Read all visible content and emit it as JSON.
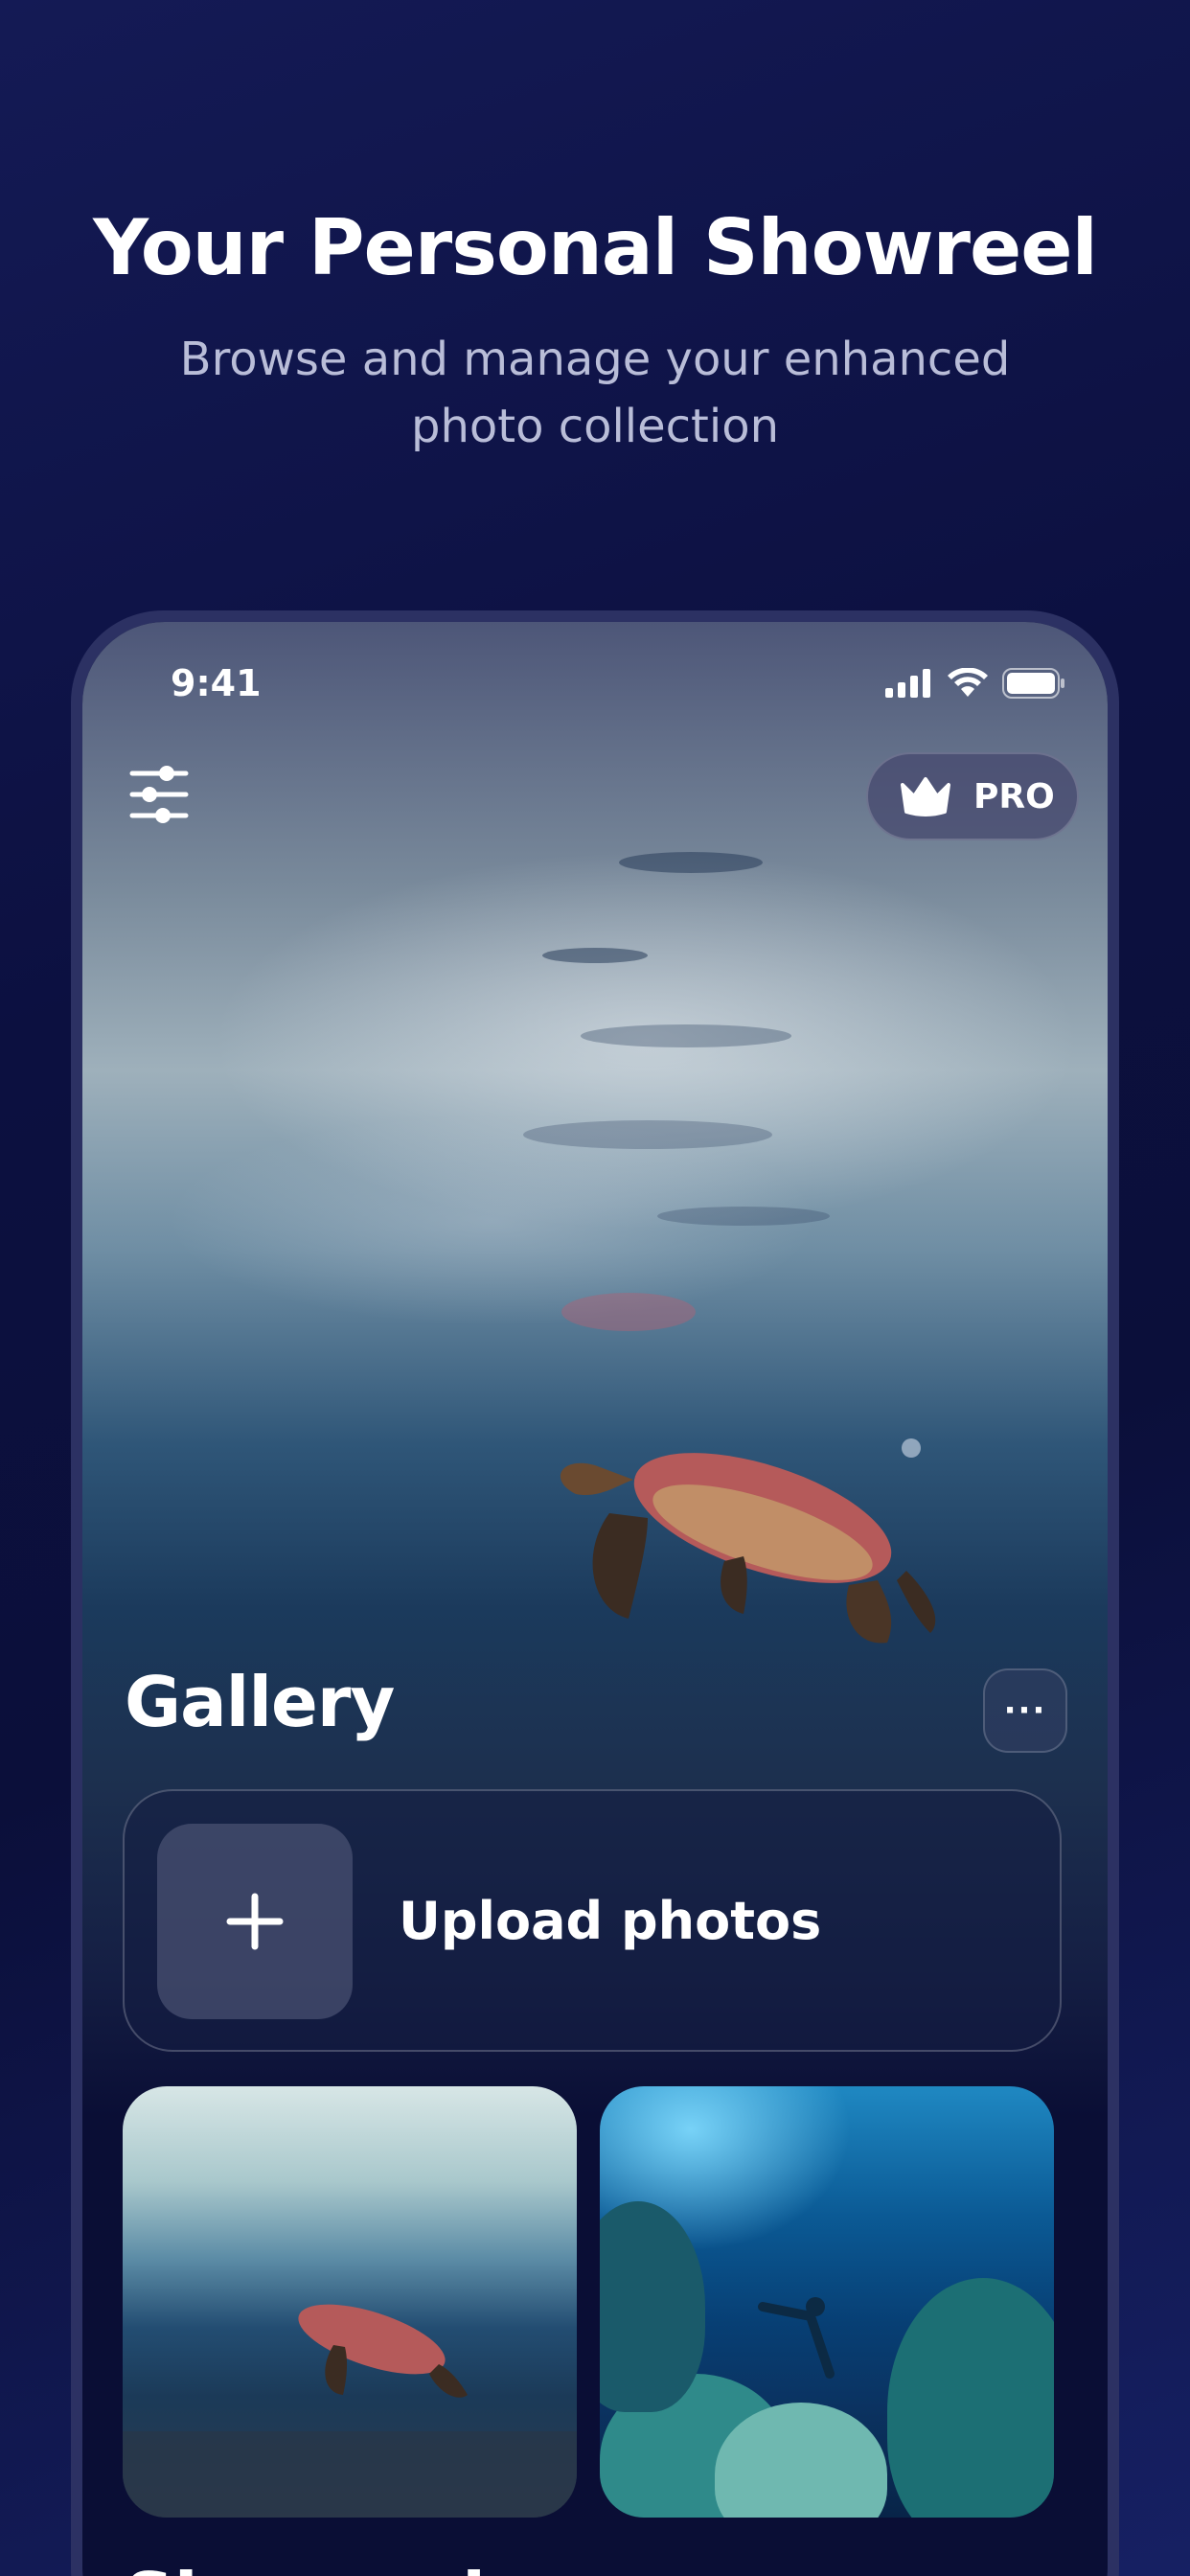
{
  "promo": {
    "title": "Your Personal Showreel",
    "subtitle": "Browse and manage your enhanced photo collection"
  },
  "status_bar": {
    "time": "9:41",
    "icons": [
      "signal-icon",
      "wifi-icon",
      "battery-icon"
    ]
  },
  "header": {
    "filter_icon": "sliders-icon",
    "pro_label": "PRO",
    "pro_icon": "crown-icon"
  },
  "gallery": {
    "title": "Gallery",
    "more_label": "···",
    "upload_label": "Upload photos",
    "upload_icon": "plus-icon",
    "photos": [
      {
        "subject": "sea turtle underwater"
      },
      {
        "subject": "divers over coral reef"
      }
    ]
  },
  "next_section": {
    "title": "Showreels"
  },
  "colors": {
    "background": "#0c1040",
    "text_primary": "#ffffff",
    "text_secondary": "#b9bdd8"
  }
}
